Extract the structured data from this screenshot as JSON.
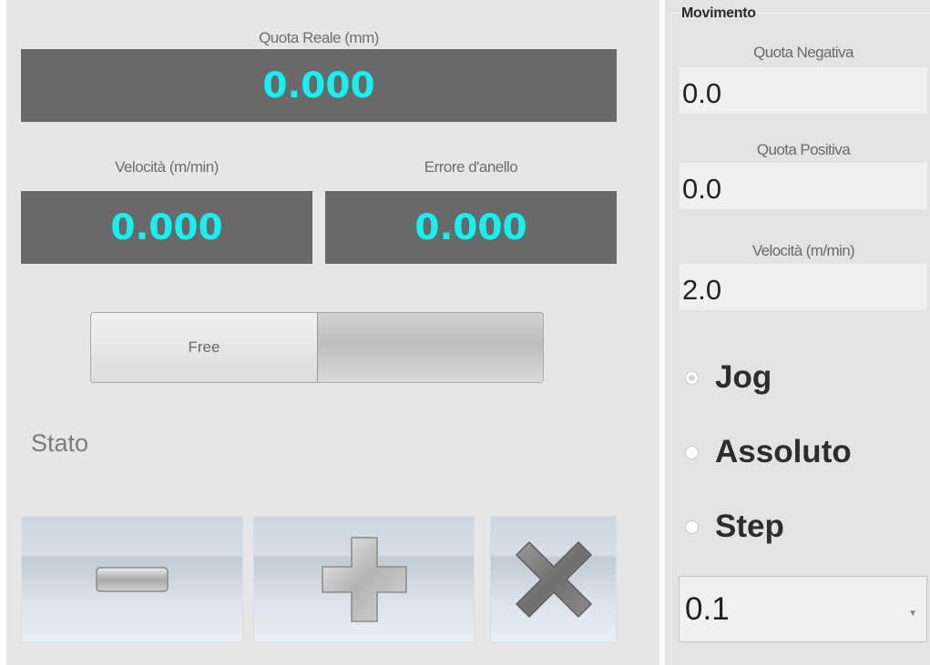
{
  "quota_reale": {
    "label": "Quota Reale (mm)",
    "value": "0.000"
  },
  "velocita": {
    "label": "Velocità (m/min)",
    "value": "0.000"
  },
  "errore": {
    "label": "Errore d'anello",
    "value": "0.000"
  },
  "toggle": {
    "free_label": "Free",
    "other_label": ""
  },
  "stato": {
    "label": "Stato"
  },
  "buttons": {
    "minus_icon": "minus-icon",
    "plus_icon": "plus-icon",
    "stop_icon": "close-icon"
  },
  "movimento": {
    "title": "Movimento",
    "quota_negativa": {
      "label": "Quota Negativa",
      "value": "0.0"
    },
    "quota_positiva": {
      "label": "Quota Positiva",
      "value": "0.0"
    },
    "velocita": {
      "label": "Velocità (m/min)",
      "value": "2.0"
    },
    "modes": [
      {
        "label": "Jog",
        "checked": true
      },
      {
        "label": "Assoluto",
        "checked": false
      },
      {
        "label": "Step",
        "checked": false
      }
    ],
    "step_select": {
      "value": "0.1"
    }
  },
  "colors": {
    "display_bg": "#696969",
    "display_text": "#15f0f0",
    "panel_bg": "#e6e6e6"
  }
}
